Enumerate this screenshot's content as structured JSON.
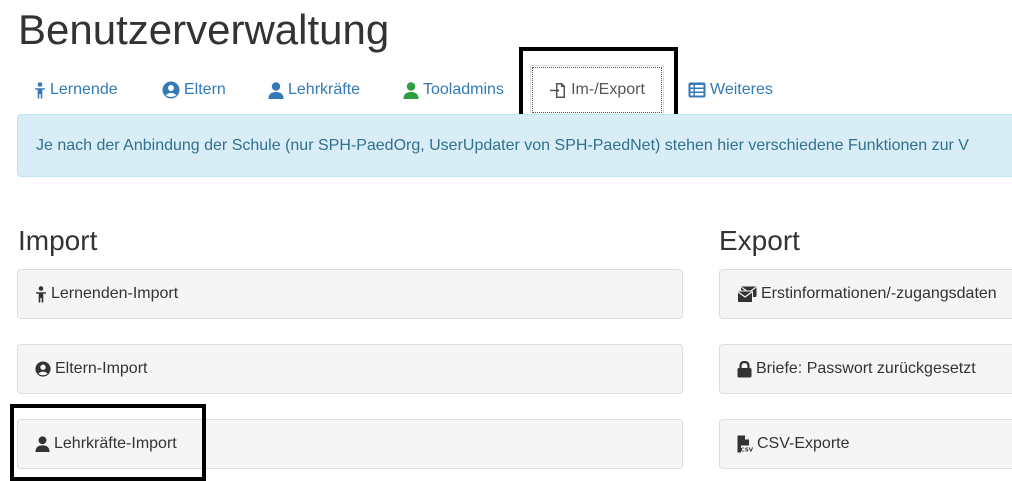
{
  "page": {
    "title": "Benutzerverwaltung"
  },
  "tabs": {
    "lernende": "Lernende",
    "eltern": "Eltern",
    "lehrkraefte": "Lehrkräfte",
    "tooladmins": "Tooladmins",
    "im_export": "Im-/Export",
    "weiteres": "Weiteres",
    "active": "Im-/Export"
  },
  "info": {
    "text": "Je nach der Anbindung der Schule (nur SPH-PaedOrg, UserUpdater von SPH-PaedNet) stehen hier verschiedene Funktionen zur V"
  },
  "import": {
    "heading": "Import",
    "items": [
      {
        "label": "Lernenden-Import",
        "icon": "child-icon"
      },
      {
        "label": "Eltern-Import",
        "icon": "user-circle-icon"
      },
      {
        "label": "Lehrkräfte-Import",
        "icon": "user-icon"
      }
    ]
  },
  "export": {
    "heading": "Export",
    "items": [
      {
        "label": "Erstinformationen/-zugangsdaten",
        "icon": "envelopes-icon"
      },
      {
        "label": "Briefe: Passwort zurückgesetzt",
        "icon": "lock-icon"
      },
      {
        "label": "CSV-Exporte",
        "icon": "file-csv-icon"
      }
    ]
  },
  "colors": {
    "link": "#337ab7",
    "tooladmin_icon": "#2e9e43",
    "info_bg": "#d9edf7",
    "info_text": "#31708f",
    "panel_bg": "#f5f5f5",
    "highlight": "#000000"
  }
}
